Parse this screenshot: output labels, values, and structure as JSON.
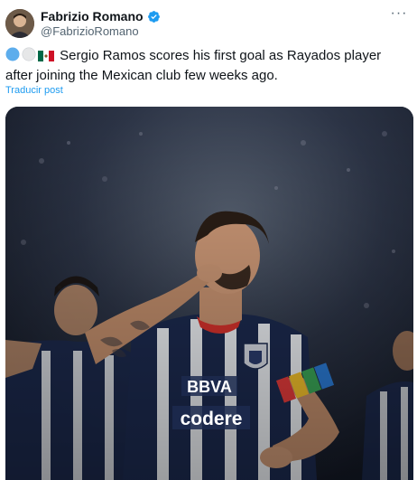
{
  "author": {
    "name": "Fabrizio Romano",
    "handle": "@FabrizioRomano",
    "verified_icon": "verified-badge-icon",
    "more_icon": "more-dots-icon"
  },
  "tweet": {
    "text": "Sergio Ramos scores his first goal as Rayados player after joining the Mexican club few weeks ago.",
    "emojis": [
      "blue-circle",
      "white-circle",
      "mexico-flag"
    ],
    "translate_label": "Traducir post"
  },
  "media": {
    "jersey_sponsor_1": "BBVA",
    "jersey_sponsor_2": "codere"
  },
  "colors": {
    "accent": "#1d9bf0",
    "text": "#0f1419",
    "secondary": "#536471",
    "jersey_navy": "#1c2a4f"
  }
}
